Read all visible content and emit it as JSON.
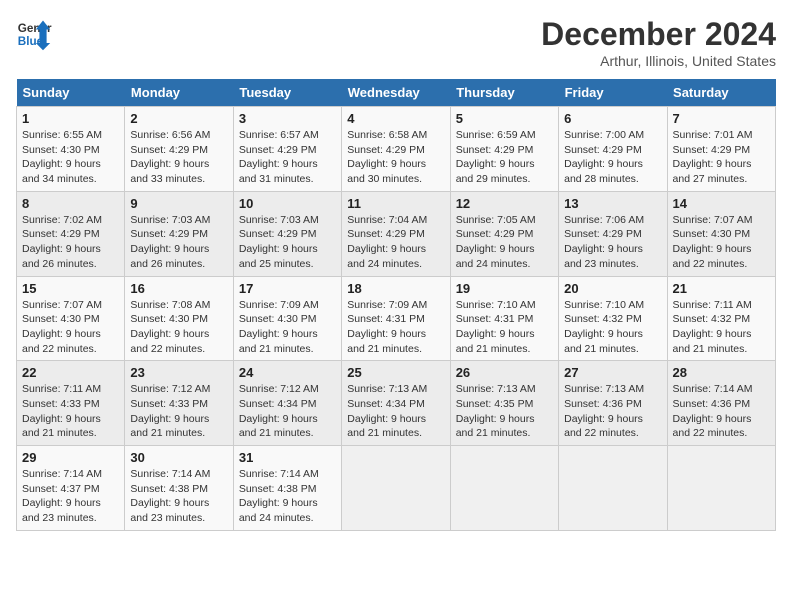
{
  "header": {
    "logo_line1": "General",
    "logo_line2": "Blue",
    "month": "December 2024",
    "location": "Arthur, Illinois, United States"
  },
  "weekdays": [
    "Sunday",
    "Monday",
    "Tuesday",
    "Wednesday",
    "Thursday",
    "Friday",
    "Saturday"
  ],
  "weeks": [
    [
      {
        "day": "1",
        "sunrise": "Sunrise: 6:55 AM",
        "sunset": "Sunset: 4:30 PM",
        "daylight": "Daylight: 9 hours and 34 minutes."
      },
      {
        "day": "2",
        "sunrise": "Sunrise: 6:56 AM",
        "sunset": "Sunset: 4:29 PM",
        "daylight": "Daylight: 9 hours and 33 minutes."
      },
      {
        "day": "3",
        "sunrise": "Sunrise: 6:57 AM",
        "sunset": "Sunset: 4:29 PM",
        "daylight": "Daylight: 9 hours and 31 minutes."
      },
      {
        "day": "4",
        "sunrise": "Sunrise: 6:58 AM",
        "sunset": "Sunset: 4:29 PM",
        "daylight": "Daylight: 9 hours and 30 minutes."
      },
      {
        "day": "5",
        "sunrise": "Sunrise: 6:59 AM",
        "sunset": "Sunset: 4:29 PM",
        "daylight": "Daylight: 9 hours and 29 minutes."
      },
      {
        "day": "6",
        "sunrise": "Sunrise: 7:00 AM",
        "sunset": "Sunset: 4:29 PM",
        "daylight": "Daylight: 9 hours and 28 minutes."
      },
      {
        "day": "7",
        "sunrise": "Sunrise: 7:01 AM",
        "sunset": "Sunset: 4:29 PM",
        "daylight": "Daylight: 9 hours and 27 minutes."
      }
    ],
    [
      {
        "day": "8",
        "sunrise": "Sunrise: 7:02 AM",
        "sunset": "Sunset: 4:29 PM",
        "daylight": "Daylight: 9 hours and 26 minutes."
      },
      {
        "day": "9",
        "sunrise": "Sunrise: 7:03 AM",
        "sunset": "Sunset: 4:29 PM",
        "daylight": "Daylight: 9 hours and 26 minutes."
      },
      {
        "day": "10",
        "sunrise": "Sunrise: 7:03 AM",
        "sunset": "Sunset: 4:29 PM",
        "daylight": "Daylight: 9 hours and 25 minutes."
      },
      {
        "day": "11",
        "sunrise": "Sunrise: 7:04 AM",
        "sunset": "Sunset: 4:29 PM",
        "daylight": "Daylight: 9 hours and 24 minutes."
      },
      {
        "day": "12",
        "sunrise": "Sunrise: 7:05 AM",
        "sunset": "Sunset: 4:29 PM",
        "daylight": "Daylight: 9 hours and 24 minutes."
      },
      {
        "day": "13",
        "sunrise": "Sunrise: 7:06 AM",
        "sunset": "Sunset: 4:29 PM",
        "daylight": "Daylight: 9 hours and 23 minutes."
      },
      {
        "day": "14",
        "sunrise": "Sunrise: 7:07 AM",
        "sunset": "Sunset: 4:30 PM",
        "daylight": "Daylight: 9 hours and 22 minutes."
      }
    ],
    [
      {
        "day": "15",
        "sunrise": "Sunrise: 7:07 AM",
        "sunset": "Sunset: 4:30 PM",
        "daylight": "Daylight: 9 hours and 22 minutes."
      },
      {
        "day": "16",
        "sunrise": "Sunrise: 7:08 AM",
        "sunset": "Sunset: 4:30 PM",
        "daylight": "Daylight: 9 hours and 22 minutes."
      },
      {
        "day": "17",
        "sunrise": "Sunrise: 7:09 AM",
        "sunset": "Sunset: 4:30 PM",
        "daylight": "Daylight: 9 hours and 21 minutes."
      },
      {
        "day": "18",
        "sunrise": "Sunrise: 7:09 AM",
        "sunset": "Sunset: 4:31 PM",
        "daylight": "Daylight: 9 hours and 21 minutes."
      },
      {
        "day": "19",
        "sunrise": "Sunrise: 7:10 AM",
        "sunset": "Sunset: 4:31 PM",
        "daylight": "Daylight: 9 hours and 21 minutes."
      },
      {
        "day": "20",
        "sunrise": "Sunrise: 7:10 AM",
        "sunset": "Sunset: 4:32 PM",
        "daylight": "Daylight: 9 hours and 21 minutes."
      },
      {
        "day": "21",
        "sunrise": "Sunrise: 7:11 AM",
        "sunset": "Sunset: 4:32 PM",
        "daylight": "Daylight: 9 hours and 21 minutes."
      }
    ],
    [
      {
        "day": "22",
        "sunrise": "Sunrise: 7:11 AM",
        "sunset": "Sunset: 4:33 PM",
        "daylight": "Daylight: 9 hours and 21 minutes."
      },
      {
        "day": "23",
        "sunrise": "Sunrise: 7:12 AM",
        "sunset": "Sunset: 4:33 PM",
        "daylight": "Daylight: 9 hours and 21 minutes."
      },
      {
        "day": "24",
        "sunrise": "Sunrise: 7:12 AM",
        "sunset": "Sunset: 4:34 PM",
        "daylight": "Daylight: 9 hours and 21 minutes."
      },
      {
        "day": "25",
        "sunrise": "Sunrise: 7:13 AM",
        "sunset": "Sunset: 4:34 PM",
        "daylight": "Daylight: 9 hours and 21 minutes."
      },
      {
        "day": "26",
        "sunrise": "Sunrise: 7:13 AM",
        "sunset": "Sunset: 4:35 PM",
        "daylight": "Daylight: 9 hours and 21 minutes."
      },
      {
        "day": "27",
        "sunrise": "Sunrise: 7:13 AM",
        "sunset": "Sunset: 4:36 PM",
        "daylight": "Daylight: 9 hours and 22 minutes."
      },
      {
        "day": "28",
        "sunrise": "Sunrise: 7:14 AM",
        "sunset": "Sunset: 4:36 PM",
        "daylight": "Daylight: 9 hours and 22 minutes."
      }
    ],
    [
      {
        "day": "29",
        "sunrise": "Sunrise: 7:14 AM",
        "sunset": "Sunset: 4:37 PM",
        "daylight": "Daylight: 9 hours and 23 minutes."
      },
      {
        "day": "30",
        "sunrise": "Sunrise: 7:14 AM",
        "sunset": "Sunset: 4:38 PM",
        "daylight": "Daylight: 9 hours and 23 minutes."
      },
      {
        "day": "31",
        "sunrise": "Sunrise: 7:14 AM",
        "sunset": "Sunset: 4:38 PM",
        "daylight": "Daylight: 9 hours and 24 minutes."
      },
      null,
      null,
      null,
      null
    ]
  ]
}
